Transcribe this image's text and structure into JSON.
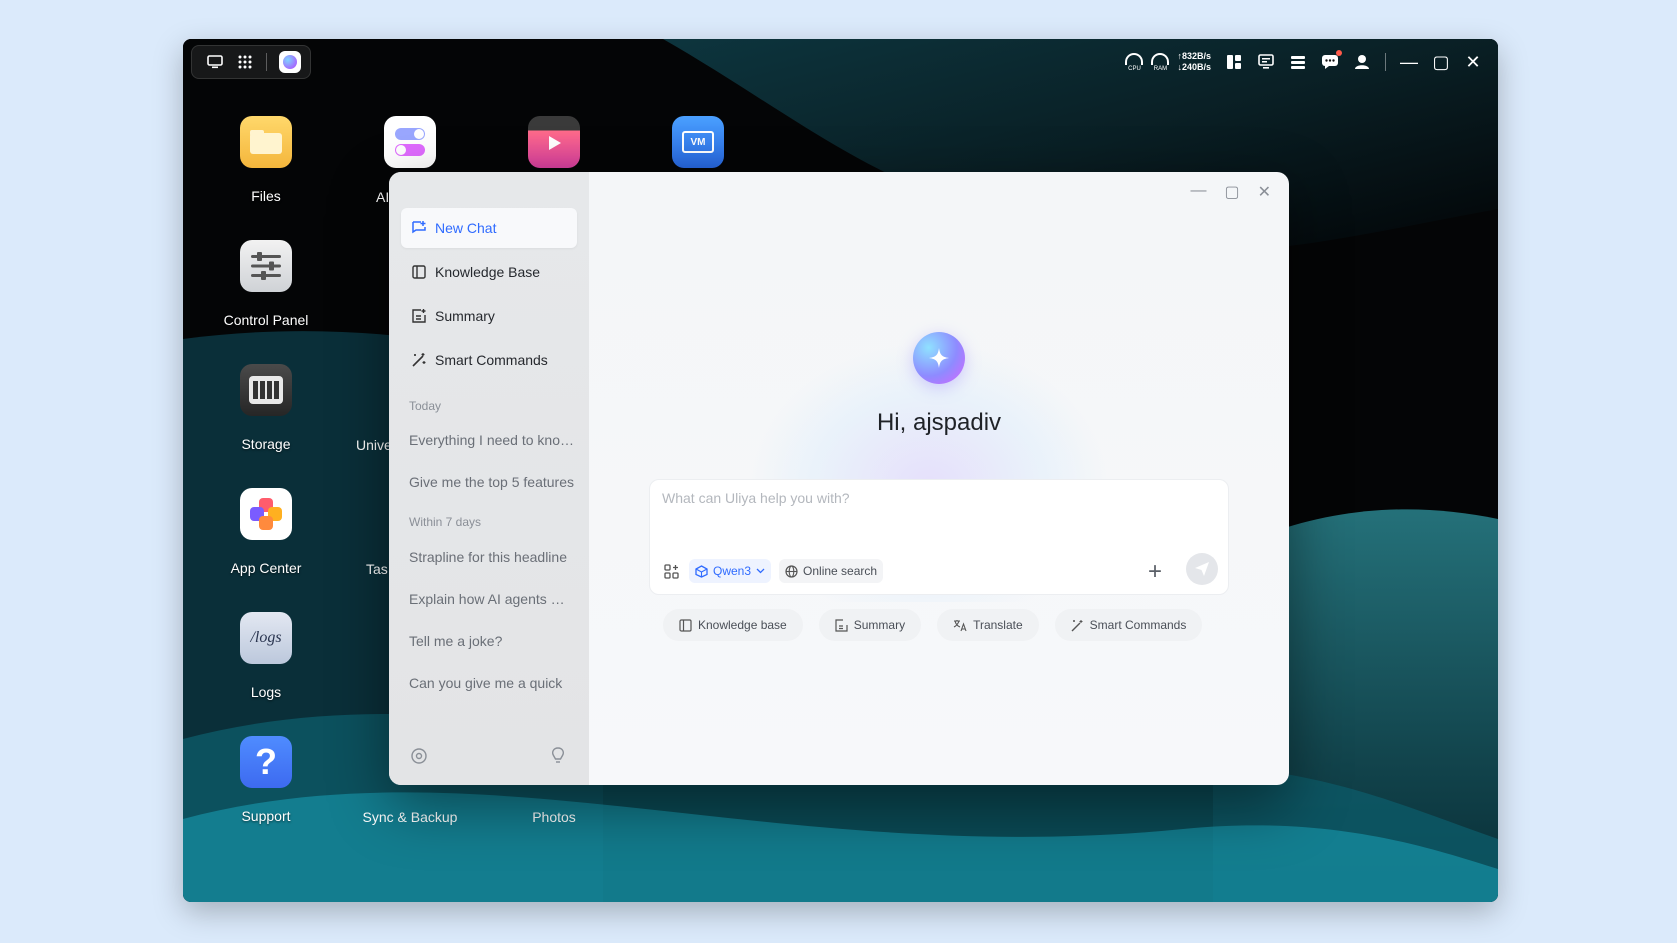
{
  "desktop": {
    "icons": [
      {
        "label": "Files",
        "icon": "folder-icon"
      },
      {
        "label": "Control Panel",
        "icon": "sliders-icon"
      },
      {
        "label": "Storage",
        "icon": "storage-icon"
      },
      {
        "label": "App Center",
        "icon": "app-center-icon"
      },
      {
        "label": "Logs",
        "icon": "logs-icon",
        "glyph": "/logs"
      },
      {
        "label": "Support",
        "icon": "question-icon",
        "glyph": "?"
      },
      {
        "label": "Sync & Backup",
        "icon": "sync-icon"
      },
      {
        "label": "Photos",
        "icon": "photos-icon"
      },
      {
        "label": "AI",
        "icon": "toggle-icon"
      },
      {
        "label": "Unive",
        "icon": "universal-icon"
      },
      {
        "label": "Tas",
        "icon": "task-icon"
      }
    ],
    "vm_badge": "VM"
  },
  "topbar": {
    "cpu_label": "CPU",
    "ram_label": "RAM",
    "net_up": "↑832B/s",
    "net_down": "↓240B/s"
  },
  "assistant": {
    "sidebar": {
      "new_chat": "New Chat",
      "knowledge_base": "Knowledge Base",
      "summary": "Summary",
      "smart_commands": "Smart Commands",
      "section_today": "Today",
      "today_items": [
        "Everything I need to know about",
        "Give me the top 5 features"
      ],
      "section_week": "Within 7 days",
      "week_items": [
        "Strapline for this headline",
        "Explain how AI agents work",
        "Tell me a joke?",
        "Can you give me a quick"
      ]
    },
    "greeting": "Hi, ajspadiv",
    "input_placeholder": "What can Uliya help you with?",
    "model": "Qwen3",
    "online_search": "Online search",
    "quick_actions": [
      "Knowledge base",
      "Summary",
      "Translate",
      "Smart Commands"
    ]
  },
  "colors": {
    "accent": "#2f6bff",
    "wallpaper_teal": "#1aa3b8"
  }
}
